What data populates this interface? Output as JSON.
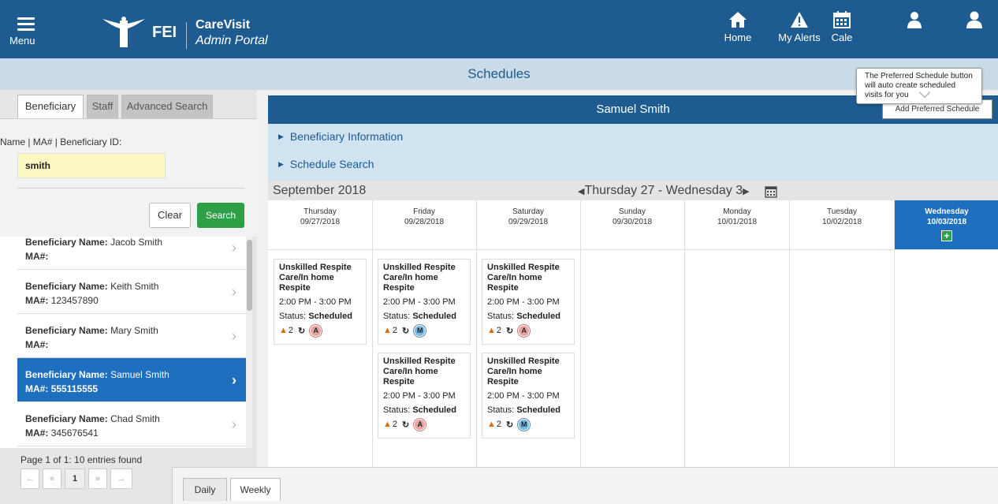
{
  "header": {
    "menu_label": "Menu",
    "brand_short": "FEI",
    "brand_name": "CareVisit",
    "brand_sub": "Admin Portal",
    "nav": [
      {
        "label": "Home",
        "icon": "home-icon"
      },
      {
        "label": "My Alerts",
        "icon": "alert-icon"
      },
      {
        "label": "Cale",
        "icon": "calendar-icon"
      },
      {
        "label": "My Staff",
        "icon": "staff-icon"
      },
      {
        "label": "Account",
        "icon": "user-icon"
      }
    ]
  },
  "tooltip": "The Preferred Schedule button will auto create scheduled visits for you",
  "page_title": "Schedules",
  "sidebar": {
    "tabs": [
      "Beneficiary",
      "Staff",
      "Advanced Search"
    ],
    "search_label": "Name | MA# | Beneficiary ID:",
    "search_value": "smith",
    "clear_label": "Clear",
    "search_label_btn": "Search",
    "name_prefix": "Beneficiary Name:",
    "ma_prefix": "MA#:",
    "results": [
      {
        "name": "Jacob Smith",
        "ma": ""
      },
      {
        "name": "Keith Smith",
        "ma": "123457890"
      },
      {
        "name": "Mary Smith",
        "ma": ""
      },
      {
        "name": "Samuel Smith",
        "ma": "555115555"
      },
      {
        "name": "Chad Smith",
        "ma": "345676541"
      }
    ],
    "paging_info": "Page 1 of 1: 10 entries found",
    "pager": [
      "←",
      "«",
      "1",
      "»",
      "→"
    ]
  },
  "main": {
    "patient_name": "Samuel Smith",
    "add_preferred_label": "Add Preferred Schedule",
    "expanders": [
      "Beneficiary Information",
      "Schedule Search"
    ],
    "month": "September 2018",
    "week_range": "Thursday 27 - Wednesday 3",
    "days": [
      {
        "name": "Thursday",
        "date": "09/27/2018"
      },
      {
        "name": "Friday",
        "date": "09/28/2018"
      },
      {
        "name": "Saturday",
        "date": "09/29/2018"
      },
      {
        "name": "Sunday",
        "date": "09/30/2018"
      },
      {
        "name": "Monday",
        "date": "10/01/2018"
      },
      {
        "name": "Tuesday",
        "date": "10/02/2018"
      },
      {
        "name": "Wednesday",
        "date": "10/03/2018"
      }
    ],
    "visit": {
      "title": "Unskilled Respite Care/In home Respite",
      "time": "2:00 PM - 3:00 PM",
      "status_prefix": "Status:",
      "status": "Scheduled",
      "alert_count": "2"
    },
    "badges": {
      "a": "A",
      "m": "M"
    }
  },
  "bottom_tabs": [
    "Daily",
    "Weekly"
  ],
  "colors": {
    "primary": "#1d5b91",
    "selected": "#1f6fbf",
    "success": "#2e9e47",
    "highlight": "#fbf8c2"
  }
}
